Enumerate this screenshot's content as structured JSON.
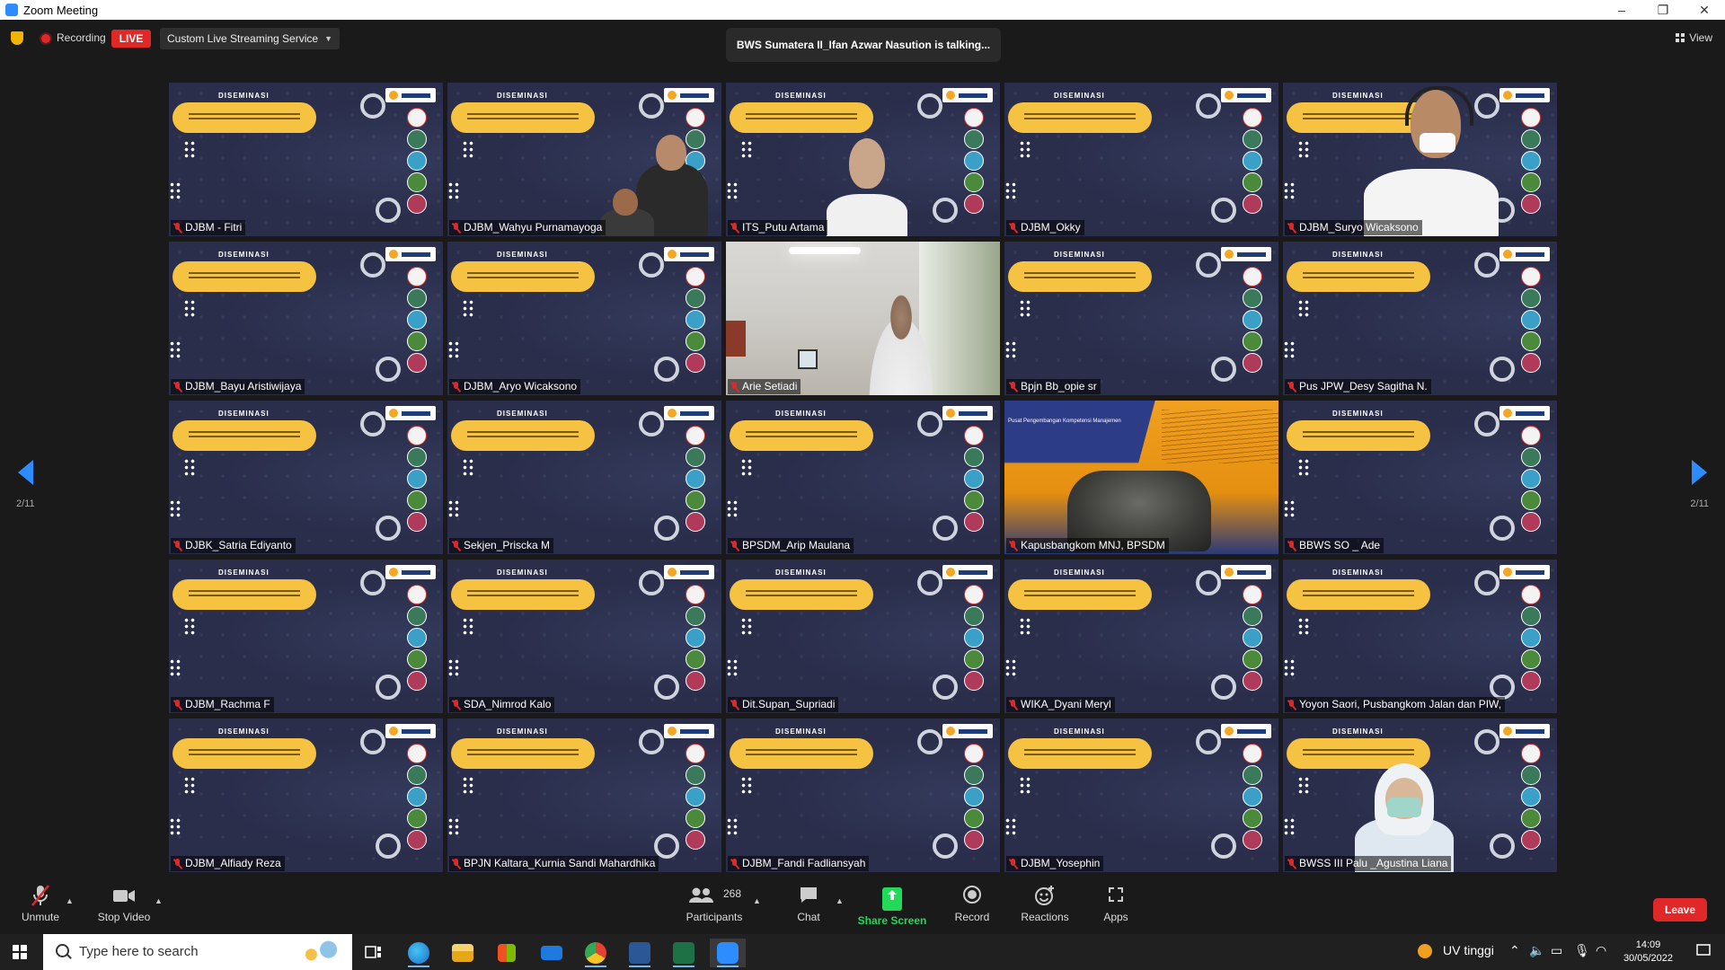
{
  "window": {
    "title": "Zoom Meeting",
    "minimize": "–",
    "restore": "❐",
    "close": "✕"
  },
  "topbar": {
    "recording": "Recording",
    "live": "LIVE",
    "stream_service": "Custom Live Streaming Service",
    "talking": "BWS Sumatera II_Ifan Azwar Nasution is talking...",
    "view": "View"
  },
  "pagination": {
    "left": "2/11",
    "right": "2/11"
  },
  "slide": {
    "heading": "DISEMINASI"
  },
  "slide2": {
    "text": "Pusat Pengembangan Kompetensi Manajemen"
  },
  "participants_grid": [
    {
      "name": "DJBM - Fitri",
      "kind": "slide"
    },
    {
      "name": "DJBM_Wahyu Purnamayoga",
      "kind": "slide-people"
    },
    {
      "name": "ITS_Putu Artama",
      "kind": "slide-man"
    },
    {
      "name": "DJBM_Okky",
      "kind": "slide"
    },
    {
      "name": "DJBM_Suryo Wicaksono",
      "kind": "slide-headset"
    },
    {
      "name": "DJBM_Bayu Aristiwijaya",
      "kind": "slide"
    },
    {
      "name": "DJBM_Aryo Wicaksono",
      "kind": "slide"
    },
    {
      "name": "Arie Setiadi",
      "kind": "video-office"
    },
    {
      "name": "Bpjn Bb_opie sr",
      "kind": "slide"
    },
    {
      "name": "Pus JPW_Desy Sagitha N.",
      "kind": "slide"
    },
    {
      "name": "DJBK_Satria Ediyanto",
      "kind": "slide"
    },
    {
      "name": "Sekjen_Priscka M",
      "kind": "slide"
    },
    {
      "name": "BPSDM_Arip Maulana",
      "kind": "slide"
    },
    {
      "name": "Kapusbangkom MNJ, BPSDM",
      "kind": "slide2"
    },
    {
      "name": "BBWS SO _ Ade",
      "kind": "slide"
    },
    {
      "name": "DJBM_Rachma F",
      "kind": "slide"
    },
    {
      "name": "SDA_Nimrod Kalo",
      "kind": "slide"
    },
    {
      "name": "Dit.Supan_Supriadi",
      "kind": "slide"
    },
    {
      "name": "WIKA_Dyani Meryl",
      "kind": "slide"
    },
    {
      "name": "Yoyon Saori, Pusbangkom Jalan dan PIW,",
      "kind": "slide"
    },
    {
      "name": "DJBM_Alfiady Reza",
      "kind": "slide"
    },
    {
      "name": "BPJN Kaltara_Kurnia Sandi Mahardhika",
      "kind": "slide"
    },
    {
      "name": "DJBM_Fandi Fadliansyah",
      "kind": "slide"
    },
    {
      "name": "DJBM_Yosephin",
      "kind": "slide"
    },
    {
      "name": "BWSS III Palu _Agustina Liana",
      "kind": "slide-woman"
    }
  ],
  "toolbar": {
    "unmute": "Unmute",
    "stop_video": "Stop Video",
    "participants_count": "268",
    "participants": "Participants",
    "chat": "Chat",
    "share_screen": "Share Screen",
    "record": "Record",
    "reactions": "Reactions",
    "apps": "Apps",
    "leave": "Leave"
  },
  "taskbar": {
    "search_placeholder": "Type here to search",
    "weather": "UV tinggi",
    "time": "14:09",
    "date": "30/05/2022"
  },
  "colors": {
    "accent": "#2d8cff",
    "live": "#e02828",
    "share": "#23d959",
    "slide_bg": "#2a2e4b",
    "pill": "#f5c242"
  }
}
